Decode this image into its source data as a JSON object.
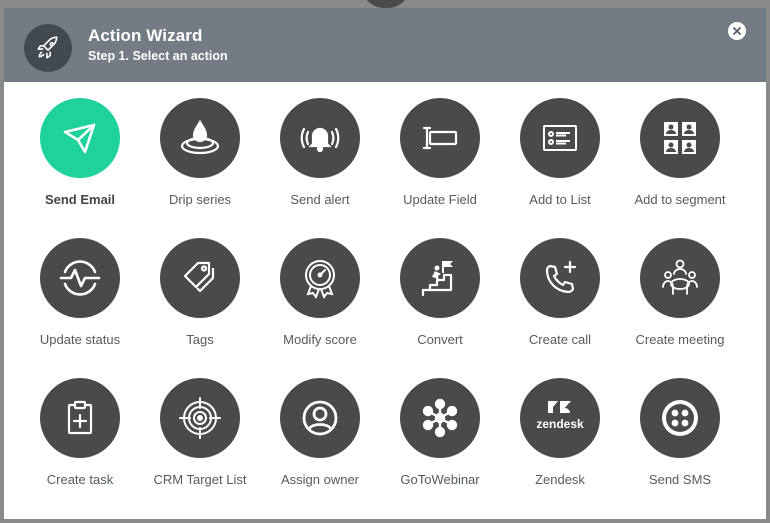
{
  "wizard": {
    "title": "Action Wizard",
    "subtitle": "Step 1. Select an action",
    "header_icon": "rocket-icon",
    "close_icon": "close-icon"
  },
  "colors": {
    "header_bg": "#737b85",
    "icon_bg": "#4a4a4a",
    "selected_bg": "#1fd19a",
    "backdrop": "#8a8a8a"
  },
  "selected_action": "Send Email",
  "actions": [
    {
      "label": "Send Email",
      "icon": "paper-plane-icon"
    },
    {
      "label": "Drip series",
      "icon": "water-drop-icon"
    },
    {
      "label": "Send alert",
      "icon": "bell-alert-icon"
    },
    {
      "label": "Update Field",
      "icon": "text-field-icon"
    },
    {
      "label": "Add to List",
      "icon": "list-card-icon"
    },
    {
      "label": "Add to segment",
      "icon": "segment-grid-icon"
    },
    {
      "label": "Update status",
      "icon": "pulse-status-icon"
    },
    {
      "label": "Tags",
      "icon": "tags-icon"
    },
    {
      "label": "Modify score",
      "icon": "score-gauge-icon"
    },
    {
      "label": "Convert",
      "icon": "stairs-flag-icon"
    },
    {
      "label": "Create call",
      "icon": "phone-add-icon"
    },
    {
      "label": "Create meeting",
      "icon": "meeting-icon"
    },
    {
      "label": "Create task",
      "icon": "clipboard-add-icon"
    },
    {
      "label": "CRM Target List",
      "icon": "target-icon"
    },
    {
      "label": "Assign owner",
      "icon": "user-circle-icon"
    },
    {
      "label": "GoToWebinar",
      "icon": "gotowebinar-icon"
    },
    {
      "label": "Zendesk",
      "icon": "zendesk-icon",
      "logo_text": "zendesk"
    },
    {
      "label": "Send SMS",
      "icon": "twilio-icon"
    }
  ]
}
